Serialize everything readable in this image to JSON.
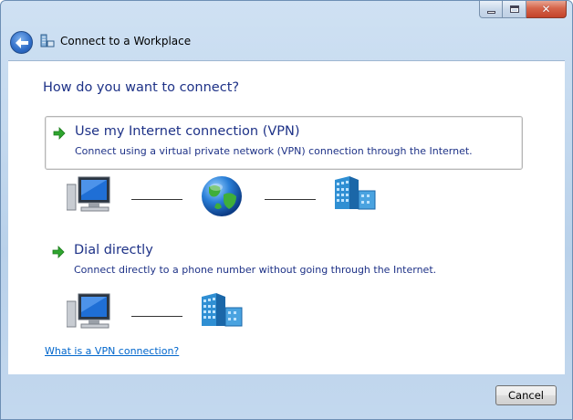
{
  "window": {
    "title": "Connect to a Workplace",
    "caption_buttons": {
      "minimize": "minimize",
      "maximize": "maximize",
      "close": "✕"
    }
  },
  "main": {
    "heading": "How do you want to connect?",
    "options": [
      {
        "title": "Use my Internet connection (VPN)",
        "mnemonic": "I",
        "description": "Connect using a virtual private network (VPN) connection through the Internet."
      },
      {
        "title": "Dial directly",
        "mnemonic": "D",
        "description": "Connect directly to a phone number without going through the Internet."
      }
    ],
    "help_link": "What is a VPN connection?"
  },
  "footer": {
    "cancel_label": "Cancel"
  },
  "colors": {
    "heading_text": "#1e3287",
    "link": "#0066cc",
    "arrow": "#2fa52f",
    "frame": "#b9d1ea"
  },
  "icons": [
    "back-arrow-icon",
    "network-icon",
    "green-arrow-icon",
    "computer-icon",
    "globe-icon",
    "building-icon",
    "close-icon"
  ]
}
